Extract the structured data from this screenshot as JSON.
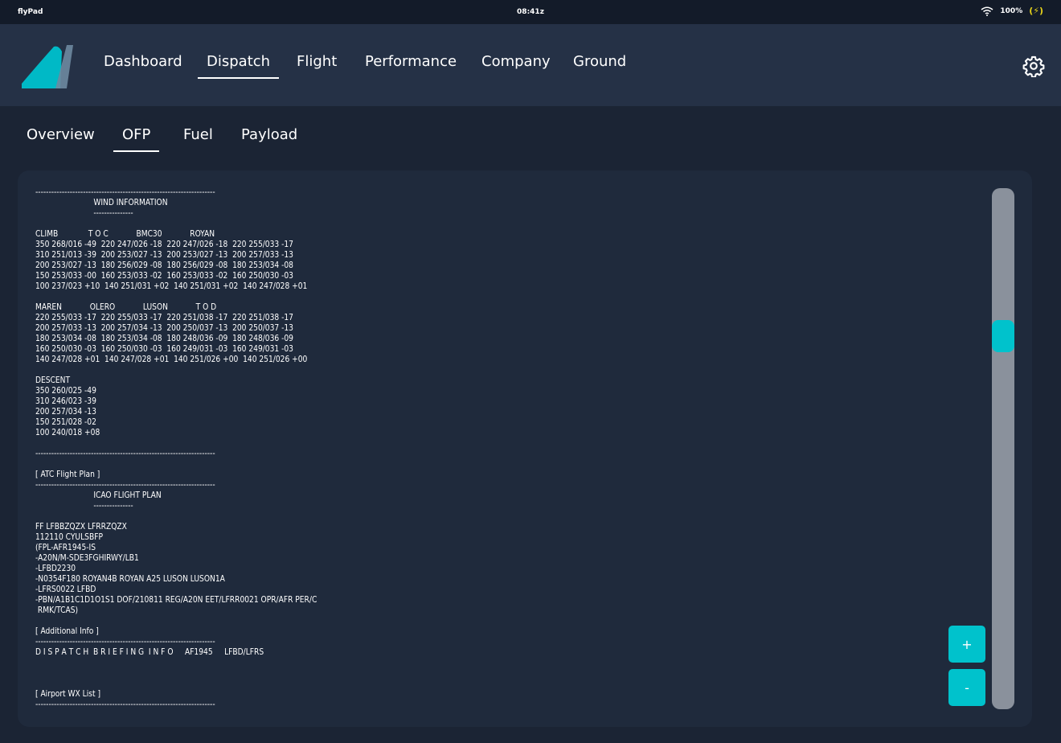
{
  "status_bar": {
    "app_name": "flyPad",
    "time": "08:41z",
    "battery": "100%",
    "charging_symbol": "(⚡)"
  },
  "nav": {
    "tabs": [
      "Dashboard",
      "Dispatch",
      "Flight",
      "Performance",
      "Company",
      "Ground"
    ],
    "active": "Dispatch"
  },
  "subnav": {
    "tabs": [
      "Overview",
      "OFP",
      "Fuel",
      "Payload"
    ],
    "active": "OFP"
  },
  "ofp": {
    "text": "--------------------------------------------------------------------\n                         WIND INFORMATION\n                         ---------------\n\nCLIMB             T O C            BMC30            ROYAN\n350 268/016 -49  220 247/026 -18  220 247/026 -18  220 255/033 -17\n310 251/013 -39  200 253/027 -13  200 253/027 -13  200 257/033 -13\n200 253/027 -13  180 256/029 -08  180 256/029 -08  180 253/034 -08\n150 253/033 -00  160 253/033 -02  160 253/033 -02  160 250/030 -03\n100 237/023 +10  140 251/031 +02  140 251/031 +02  140 247/028 +01\n\nMAREN            OLERO            LUSON            T O D\n220 255/033 -17  220 255/033 -17  220 251/038 -17  220 251/038 -17\n200 257/033 -13  200 257/034 -13  200 250/037 -13  200 250/037 -13\n180 253/034 -08  180 253/034 -08  180 248/036 -09  180 248/036 -09\n160 250/030 -03  160 250/030 -03  160 249/031 -03  160 249/031 -03\n140 247/028 +01  140 247/028 +01  140 251/026 +00  140 251/026 +00\n\nDESCENT\n350 260/025 -49\n310 246/023 -39\n200 257/034 -13\n150 251/028 -02\n100 240/018 +08\n\n--------------------------------------------------------------------\n\n[ ATC Flight Plan ]\n--------------------------------------------------------------------\n                         ICAO FLIGHT PLAN\n                         ---------------\n\nFF LFBBZQZX LFRRZQZX\n112110 CYULSBFP\n(FPL-AFR1945-IS\n-A20N/M-SDE3FGHIRWY/LB1\n-LFBD2230\n-N0354F180 ROYAN4B ROYAN A25 LUSON LUSON1A\n-LFRS0022 LFBD\n-PBN/A1B1C1D1O1S1 DOF/210811 REG/A20N EET/LFRR0021 OPR/AFR PER/C\n RMK/TCAS)\n\n[ Additional Info ]\n--------------------------------------------------------------------\nD I S P A T C H  B R I E F I N G  I N F O     AF1945     LFBD/LFRS\n\n\n\n[ Airport WX List ]\n--------------------------------------------------------------------"
  },
  "controls": {
    "zoom_in": "+",
    "zoom_out": "-",
    "scroll_fraction": 0.27
  },
  "colors": {
    "accent": "#00c2cc",
    "background": "#1b2434",
    "nav_background": "#253146",
    "panel": "#1f2a3c"
  }
}
